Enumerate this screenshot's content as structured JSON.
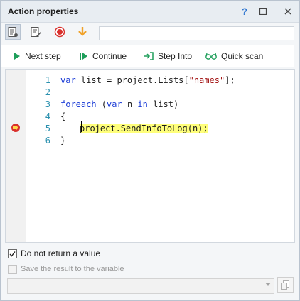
{
  "window": {
    "title": "Action properties"
  },
  "titlebar": {
    "help": "?"
  },
  "toolbar1": {
    "icons": [
      "code-view-icon",
      "edit-code-icon",
      "record-icon",
      "download-arrow-icon"
    ],
    "field_value": ""
  },
  "toolbar2": {
    "next_step": "Next step",
    "continue": "Continue",
    "step_into": "Step Into",
    "quick_scan": "Quick scan"
  },
  "editor": {
    "lines": [
      {
        "num": "1",
        "text": "var list = project.Lists[\"names\"];"
      },
      {
        "num": "2",
        "text": ""
      },
      {
        "num": "3",
        "text": "foreach (var n in list)"
      },
      {
        "num": "4",
        "text": "{"
      },
      {
        "num": "5",
        "text": "project.SendInfoToLog(n);"
      },
      {
        "num": "6",
        "text": "}"
      }
    ],
    "breakpoint_line": "5"
  },
  "options": {
    "no_return_label": "Do not return a value",
    "no_return_checked": true,
    "save_result_label": "Save the result to the variable",
    "save_result_checked": false
  },
  "variable_select": {
    "value": ""
  },
  "colors": {
    "accent": "#2f76d0",
    "highlight": "#ffff7a",
    "breakpoint": "#d9302c",
    "play_green": "#1e9e5a"
  }
}
